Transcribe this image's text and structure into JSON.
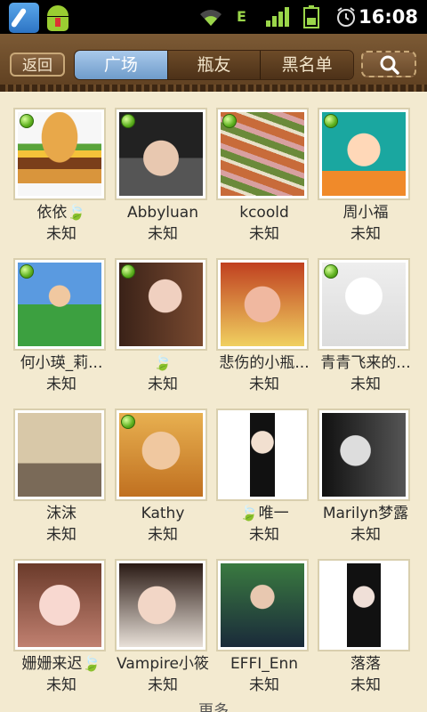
{
  "statusbar": {
    "time": "16:08",
    "network_label": "E"
  },
  "topbar": {
    "back_label": "返回",
    "tabs": [
      {
        "label": "广场",
        "active": true
      },
      {
        "label": "瓶友",
        "active": false
      },
      {
        "label": "黑名单",
        "active": false
      }
    ]
  },
  "users": [
    {
      "name": "依依🍃",
      "status": "未知",
      "online": true
    },
    {
      "name": "Abbyluan",
      "status": "未知",
      "online": true
    },
    {
      "name": "kcoold",
      "status": "未知",
      "online": true
    },
    {
      "name": "周小福",
      "status": "未知",
      "online": true
    },
    {
      "name": "何小瑛_莉...",
      "status": "未知",
      "online": true
    },
    {
      "name": "🍃",
      "status": "未知",
      "online": true
    },
    {
      "name": "悲伤的小瓶...",
      "status": "未知",
      "online": false
    },
    {
      "name": "青青飞来的...",
      "status": "未知",
      "online": true
    },
    {
      "name": "沫沫",
      "status": "未知",
      "online": false
    },
    {
      "name": "Kathy",
      "status": "未知",
      "online": true
    },
    {
      "name": "🍃唯一",
      "status": "未知",
      "online": false
    },
    {
      "name": "Marilyn梦露",
      "status": "未知",
      "online": false
    },
    {
      "name": "姗姗来迟🍃",
      "status": "未知",
      "online": false
    },
    {
      "name": "Vampire小筱",
      "status": "未知",
      "online": false
    },
    {
      "name": "EFFI_Enn",
      "status": "未知",
      "online": false
    },
    {
      "name": "落落",
      "status": "未知",
      "online": false
    }
  ],
  "footer_peek": "更多",
  "colors": {
    "background": "#f3ead0",
    "topbar": "#6d4b28",
    "active_tab": "#8fb4dc",
    "online_dot": "#5db01e"
  }
}
